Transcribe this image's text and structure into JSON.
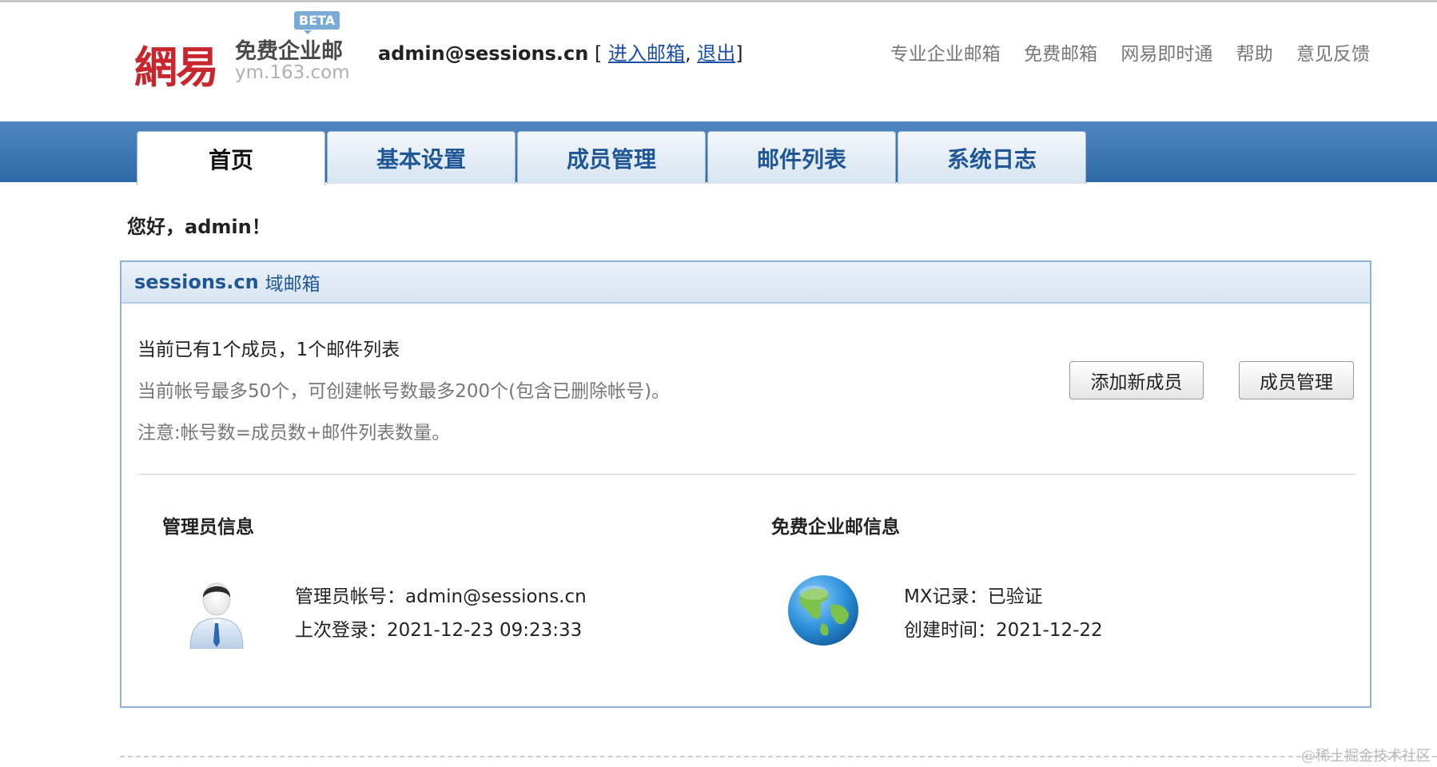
{
  "logo": {
    "mark": "網易",
    "name": "免费企业邮",
    "url": "ym.163.com",
    "badge": "BETA"
  },
  "user": {
    "email": "admin@sessions.cn",
    "open_bracket": " [ ",
    "enter_mailbox": "进入邮箱",
    "separator": ", ",
    "logout": "退出",
    "close_bracket": "]"
  },
  "top_links": [
    "专业企业邮箱",
    "免费邮箱",
    "网易即时通",
    "帮助",
    "意见反馈"
  ],
  "tabs": [
    {
      "label": "首页",
      "active": true
    },
    {
      "label": "基本设置",
      "active": false
    },
    {
      "label": "成员管理",
      "active": false
    },
    {
      "label": "邮件列表",
      "active": false
    },
    {
      "label": "系统日志",
      "active": false
    }
  ],
  "greeting": "您好，admin！",
  "panel": {
    "domain": "sessions.cn",
    "domain_suffix": "域邮箱",
    "summary_main": "当前已有1个成员，1个邮件列表",
    "summary_limit": "当前帐号最多50个，可创建帐号数最多200个(包含已删除帐号)。",
    "summary_note": "注意:帐号数=成员数+邮件列表数量。",
    "add_member_button": "添加新成员",
    "manage_members_button": "成员管理",
    "admin_info_title": "管理员信息",
    "admin_account": "管理员帐号：admin@sessions.cn",
    "last_login": "上次登录：2021-12-23 09:23:33",
    "free_info_title": "免费企业邮信息",
    "mx_record": "MX记录：已验证",
    "created_time": "创建时间：2021-12-22"
  },
  "watermark": "@稀土掘金技术社区",
  "colors": {
    "brand_red": "#c8262c",
    "nav_blue": "#2f6aa8",
    "tab_text": "#1f5796",
    "link": "#1a4fa3"
  }
}
